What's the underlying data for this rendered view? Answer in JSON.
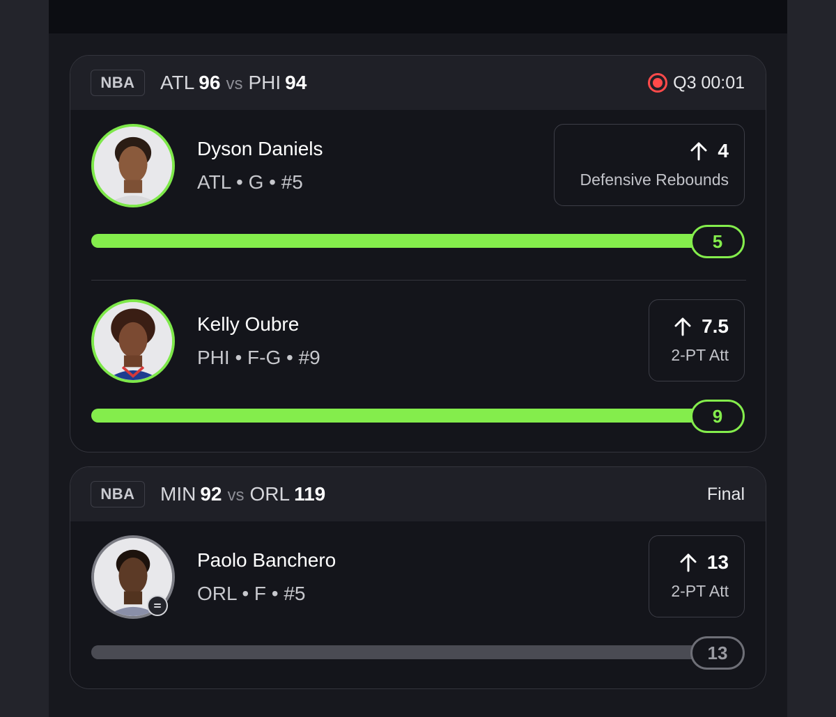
{
  "games": [
    {
      "league": "NBA",
      "away_team": "ATL",
      "away_score": "96",
      "vs": "vs",
      "home_team": "PHI",
      "home_score": "94",
      "status": "Q3 00:01",
      "live": true,
      "players": [
        {
          "name": "Dyson Daniels",
          "meta": "ATL • G • #5",
          "line": "4",
          "stat": "Defensive Rebounds",
          "current": "5",
          "progress": 1.0,
          "direction_icon": "arrow-up-icon"
        },
        {
          "name": "Kelly Oubre",
          "meta": "PHI • F-G • #9",
          "line": "7.5",
          "stat": "2-PT Att",
          "current": "9",
          "progress": 1.0,
          "direction_icon": "arrow-up-icon"
        }
      ]
    },
    {
      "league": "NBA",
      "away_team": "MIN",
      "away_score": "92",
      "vs": "vs",
      "home_team": "ORL",
      "home_score": "119",
      "status": "Final",
      "live": false,
      "players": [
        {
          "name": "Paolo Banchero",
          "meta": "ORL • F • #5",
          "line": "13",
          "stat": "2-PT Att",
          "current": "13",
          "progress": 1.0,
          "direction_icon": "arrow-up-icon"
        }
      ]
    }
  ],
  "colors": {
    "accent_green": "#84ed4c",
    "live_red": "#ff4a4a",
    "settled_gray": "#4a4b53"
  }
}
